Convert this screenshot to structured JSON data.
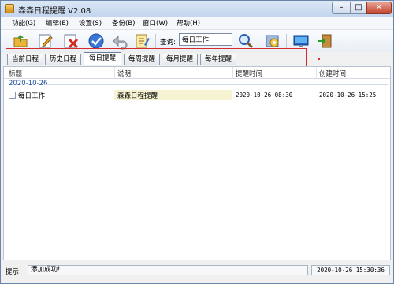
{
  "window": {
    "title": "森森日程提醒 V2.08",
    "min": "–",
    "max": "□",
    "close": "✕"
  },
  "menu": [
    {
      "label": "功能(G)"
    },
    {
      "label": "编辑(E)"
    },
    {
      "label": "设置(S)"
    },
    {
      "label": "备份(B)"
    },
    {
      "label": "窗口(W)"
    },
    {
      "label": "帮助(H)"
    }
  ],
  "toolbar": {
    "search_label": "查询:",
    "search_value": "每日工作",
    "icons": [
      "open-folder-icon",
      "edit-icon",
      "delete-icon",
      "check-icon",
      "undo-icon",
      "notepad-icon",
      "search-icon",
      "settings-icon",
      "monitor-icon",
      "exit-icon"
    ]
  },
  "tabs": [
    {
      "label": "当前日程"
    },
    {
      "label": "历史日程"
    },
    {
      "label": "每日提醒"
    },
    {
      "label": "每周提醒"
    },
    {
      "label": "每月提醒"
    },
    {
      "label": "每年提醒"
    }
  ],
  "active_tab": "每日提醒",
  "columns": [
    "标题",
    "说明",
    "提醒时间",
    "创建时间"
  ],
  "group_date": "2020-10-26",
  "rows": [
    {
      "title": "每日工作",
      "desc": "森森日程提醒",
      "remind": "2020-10-26 08:30",
      "created": "2020-10-26 15:25"
    }
  ],
  "status": {
    "label": "提示:",
    "message": "添加成功!",
    "time": "2020-10-26 15:30:36"
  },
  "colors": {
    "highlight": "#d72a2a",
    "group": "#1e4e9a",
    "row_desc": "#f6f3d2"
  }
}
